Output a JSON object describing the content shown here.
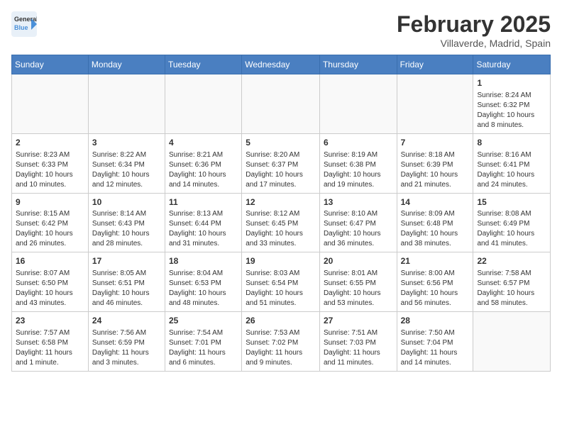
{
  "app": {
    "name_general": "General",
    "name_blue": "Blue"
  },
  "header": {
    "month": "February 2025",
    "location": "Villaverde, Madrid, Spain"
  },
  "weekdays": [
    "Sunday",
    "Monday",
    "Tuesday",
    "Wednesday",
    "Thursday",
    "Friday",
    "Saturday"
  ],
  "weeks": [
    [
      {
        "day": "",
        "info": ""
      },
      {
        "day": "",
        "info": ""
      },
      {
        "day": "",
        "info": ""
      },
      {
        "day": "",
        "info": ""
      },
      {
        "day": "",
        "info": ""
      },
      {
        "day": "",
        "info": ""
      },
      {
        "day": "1",
        "info": "Sunrise: 8:24 AM\nSunset: 6:32 PM\nDaylight: 10 hours and 8 minutes."
      }
    ],
    [
      {
        "day": "2",
        "info": "Sunrise: 8:23 AM\nSunset: 6:33 PM\nDaylight: 10 hours and 10 minutes."
      },
      {
        "day": "3",
        "info": "Sunrise: 8:22 AM\nSunset: 6:34 PM\nDaylight: 10 hours and 12 minutes."
      },
      {
        "day": "4",
        "info": "Sunrise: 8:21 AM\nSunset: 6:36 PM\nDaylight: 10 hours and 14 minutes."
      },
      {
        "day": "5",
        "info": "Sunrise: 8:20 AM\nSunset: 6:37 PM\nDaylight: 10 hours and 17 minutes."
      },
      {
        "day": "6",
        "info": "Sunrise: 8:19 AM\nSunset: 6:38 PM\nDaylight: 10 hours and 19 minutes."
      },
      {
        "day": "7",
        "info": "Sunrise: 8:18 AM\nSunset: 6:39 PM\nDaylight: 10 hours and 21 minutes."
      },
      {
        "day": "8",
        "info": "Sunrise: 8:16 AM\nSunset: 6:41 PM\nDaylight: 10 hours and 24 minutes."
      }
    ],
    [
      {
        "day": "9",
        "info": "Sunrise: 8:15 AM\nSunset: 6:42 PM\nDaylight: 10 hours and 26 minutes."
      },
      {
        "day": "10",
        "info": "Sunrise: 8:14 AM\nSunset: 6:43 PM\nDaylight: 10 hours and 28 minutes."
      },
      {
        "day": "11",
        "info": "Sunrise: 8:13 AM\nSunset: 6:44 PM\nDaylight: 10 hours and 31 minutes."
      },
      {
        "day": "12",
        "info": "Sunrise: 8:12 AM\nSunset: 6:45 PM\nDaylight: 10 hours and 33 minutes."
      },
      {
        "day": "13",
        "info": "Sunrise: 8:10 AM\nSunset: 6:47 PM\nDaylight: 10 hours and 36 minutes."
      },
      {
        "day": "14",
        "info": "Sunrise: 8:09 AM\nSunset: 6:48 PM\nDaylight: 10 hours and 38 minutes."
      },
      {
        "day": "15",
        "info": "Sunrise: 8:08 AM\nSunset: 6:49 PM\nDaylight: 10 hours and 41 minutes."
      }
    ],
    [
      {
        "day": "16",
        "info": "Sunrise: 8:07 AM\nSunset: 6:50 PM\nDaylight: 10 hours and 43 minutes."
      },
      {
        "day": "17",
        "info": "Sunrise: 8:05 AM\nSunset: 6:51 PM\nDaylight: 10 hours and 46 minutes."
      },
      {
        "day": "18",
        "info": "Sunrise: 8:04 AM\nSunset: 6:53 PM\nDaylight: 10 hours and 48 minutes."
      },
      {
        "day": "19",
        "info": "Sunrise: 8:03 AM\nSunset: 6:54 PM\nDaylight: 10 hours and 51 minutes."
      },
      {
        "day": "20",
        "info": "Sunrise: 8:01 AM\nSunset: 6:55 PM\nDaylight: 10 hours and 53 minutes."
      },
      {
        "day": "21",
        "info": "Sunrise: 8:00 AM\nSunset: 6:56 PM\nDaylight: 10 hours and 56 minutes."
      },
      {
        "day": "22",
        "info": "Sunrise: 7:58 AM\nSunset: 6:57 PM\nDaylight: 10 hours and 58 minutes."
      }
    ],
    [
      {
        "day": "23",
        "info": "Sunrise: 7:57 AM\nSunset: 6:58 PM\nDaylight: 11 hours and 1 minute."
      },
      {
        "day": "24",
        "info": "Sunrise: 7:56 AM\nSunset: 6:59 PM\nDaylight: 11 hours and 3 minutes."
      },
      {
        "day": "25",
        "info": "Sunrise: 7:54 AM\nSunset: 7:01 PM\nDaylight: 11 hours and 6 minutes."
      },
      {
        "day": "26",
        "info": "Sunrise: 7:53 AM\nSunset: 7:02 PM\nDaylight: 11 hours and 9 minutes."
      },
      {
        "day": "27",
        "info": "Sunrise: 7:51 AM\nSunset: 7:03 PM\nDaylight: 11 hours and 11 minutes."
      },
      {
        "day": "28",
        "info": "Sunrise: 7:50 AM\nSunset: 7:04 PM\nDaylight: 11 hours and 14 minutes."
      },
      {
        "day": "",
        "info": ""
      }
    ]
  ]
}
